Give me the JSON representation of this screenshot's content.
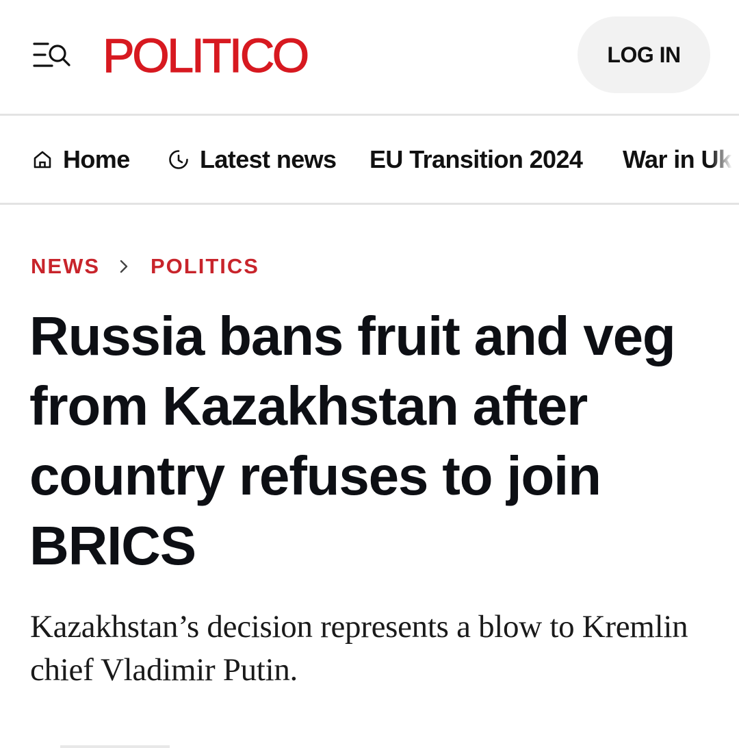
{
  "header": {
    "logo_text": "POLITICO",
    "menu_icon": "menu-search-icon",
    "login_label": "LOG IN",
    "brand_color": "#d71920"
  },
  "nav": {
    "items": [
      {
        "label": "Home",
        "icon": "home-icon"
      },
      {
        "label": "Latest news",
        "icon": "clock-icon"
      },
      {
        "label": "EU Transition 2024",
        "icon": ""
      },
      {
        "label": "War in Ukraine",
        "icon": ""
      }
    ]
  },
  "breadcrumb": {
    "section": "NEWS",
    "subsection": "POLITICS",
    "separator_icon": "chevron-right-icon",
    "accent_color": "#c8242b"
  },
  "article": {
    "headline": "Russia bans fruit and veg from Kazakhstan after country refuses to join BRICS",
    "deck": "Kazakhstan’s decision represents a blow to Kremlin chief Vladimir Putin."
  }
}
